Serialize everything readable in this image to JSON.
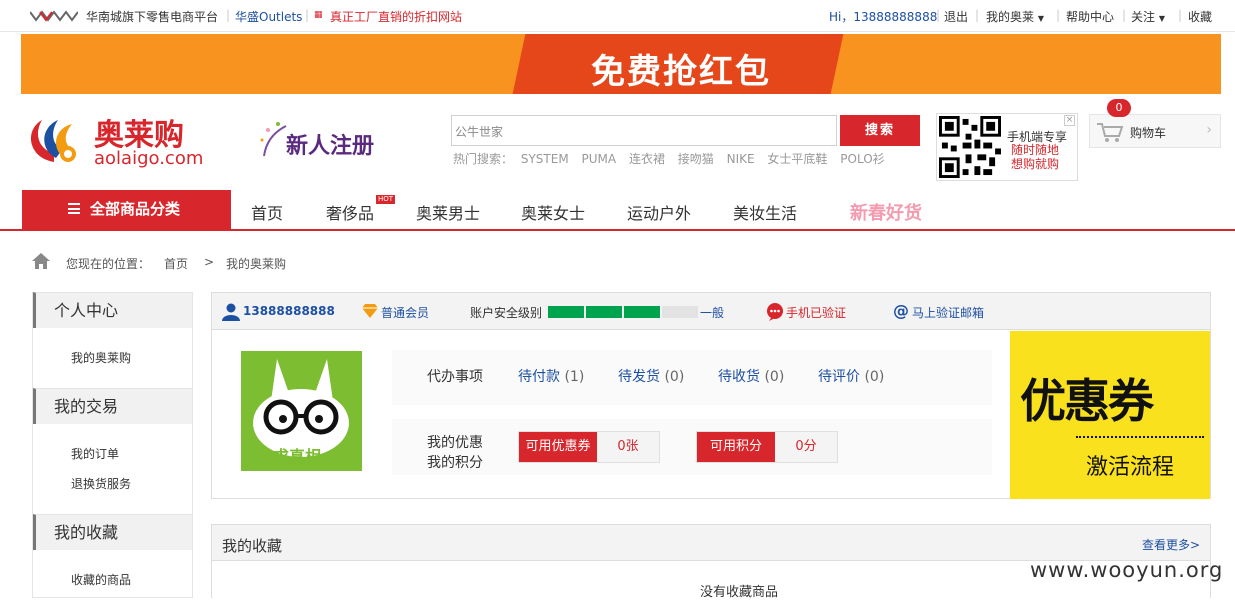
{
  "topbar": {
    "tagline": "华南城旗下零售电商平台",
    "outlets": "华盛Outlets",
    "slogan": "真正工厂直销的折扣网站",
    "greeting": "Hi，13888888888",
    "logout": "退出",
    "my_account": "我的奥莱",
    "help": "帮助中心",
    "follow": "关注",
    "favorite": "收藏"
  },
  "banner": {
    "text": "免费抢红包"
  },
  "header": {
    "brand_name": "奥莱购",
    "brand_domain": "aolaigo.com",
    "register": "新人注册",
    "search_placeholder": "公牛世家",
    "search_button": "搜索",
    "hot_label": "热门搜索：",
    "hot_terms": [
      "SYSTEM",
      "PUMA",
      "连衣裙",
      "接吻猫",
      "NIKE",
      "女士平底鞋",
      "POLO衫"
    ],
    "qr_title": "手机端专享",
    "qr_line1": "随时随地",
    "qr_line2": "想购就购",
    "qr_close": "×",
    "cart_label": "购物车",
    "cart_count": "0"
  },
  "nav": {
    "all_categories": "全部商品分类",
    "items": [
      "首页",
      "奢侈品",
      "奥莱男士",
      "奥莱女士",
      "运动户外",
      "美妆生活"
    ],
    "hot_badge": "HOT",
    "festive": "新春好货"
  },
  "breadcrumb": {
    "label": "您现在的位置：",
    "home": "首页",
    "sep": ">",
    "current": "我的奥莱购"
  },
  "sidebar": {
    "sections": [
      {
        "title": "个人中心",
        "items": [
          "我的奥莱购"
        ]
      },
      {
        "title": "我的交易",
        "items": [
          "我的订单",
          "退换货服务"
        ]
      },
      {
        "title": "我的收藏",
        "items": [
          "收藏的商品"
        ]
      }
    ]
  },
  "account": {
    "username": "13888888888",
    "level": "普通会员",
    "security_label": "账户安全级别",
    "security_level": "一般",
    "security_filled": 3,
    "security_total": 4,
    "phone_status": "手机已验证",
    "email_action": "马上验证邮箱",
    "avatar_caption": "求真相"
  },
  "tasks": {
    "label": "代办事项",
    "pending_payment": "待付款",
    "pending_payment_count": "(1)",
    "pending_shipment": "待发货",
    "pending_shipment_count": "(0)",
    "pending_receipt": "待收货",
    "pending_receipt_count": "(0)",
    "pending_review": "待评价",
    "pending_review_count": "(0)"
  },
  "benefits": {
    "label1": "我的优惠",
    "label2": "我的积分",
    "coupon_label": "可用优惠券",
    "coupon_value": "0张",
    "points_label": "可用积分",
    "points_value": "0分"
  },
  "coupon_ad": {
    "title": "优惠券",
    "subtitle": "激活流程"
  },
  "favorites": {
    "title": "我的收藏",
    "more": "查看更多>",
    "empty": "没有收藏商品"
  },
  "watermark": "www.wooyun.org",
  "colors": {
    "brand_red": "#d7262c",
    "banner_orange": "#f7931e",
    "security_green": "#00a34e",
    "link_blue": "#1e50a2",
    "coupon_yellow": "#f9e21d"
  }
}
